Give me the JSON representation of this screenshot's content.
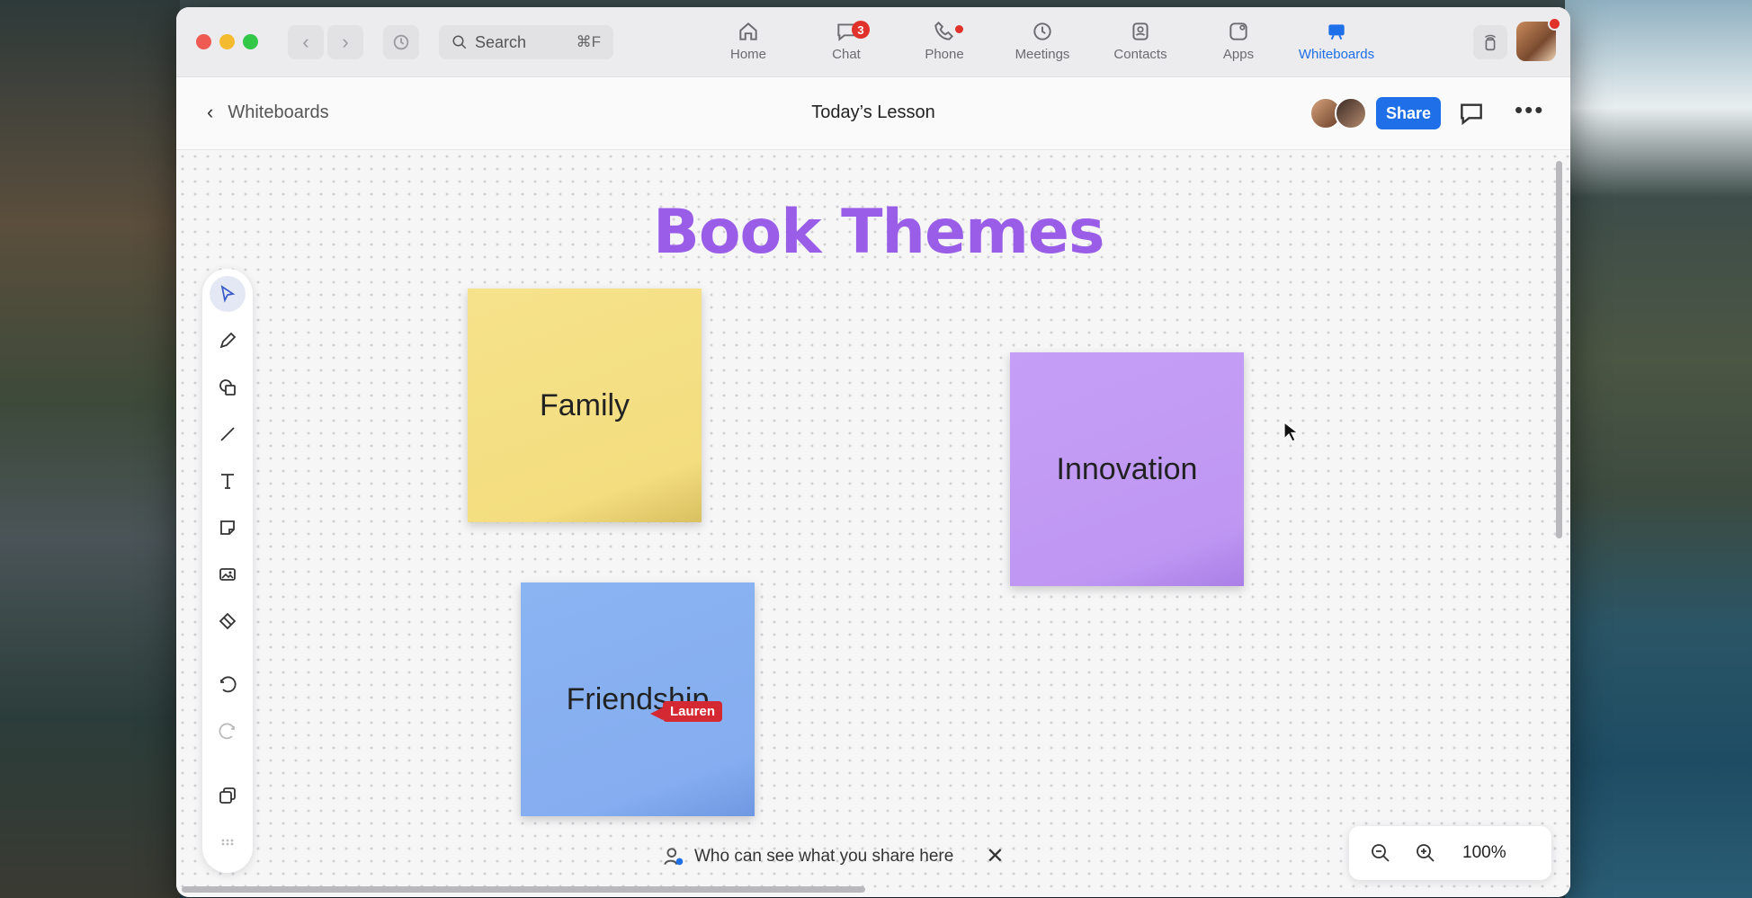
{
  "search": {
    "label": "Search",
    "shortcut": "⌘F"
  },
  "nav_tabs": [
    {
      "label": "Home",
      "icon": "home-icon"
    },
    {
      "label": "Chat",
      "icon": "chat-icon",
      "badge": "3"
    },
    {
      "label": "Phone",
      "icon": "phone-icon"
    },
    {
      "label": "Meetings",
      "icon": "clock-icon"
    },
    {
      "label": "Contacts",
      "icon": "contacts-icon"
    },
    {
      "label": "Apps",
      "icon": "apps-icon"
    },
    {
      "label": "Whiteboards",
      "icon": "whiteboard-icon",
      "active": true
    }
  ],
  "subbar": {
    "back_label": "Whiteboards",
    "title": "Today’s Lesson",
    "share_label": "Share"
  },
  "board": {
    "title": "Book Themes",
    "title_color": "#9a5de8",
    "notes": [
      {
        "text": "Family",
        "color": "#f3dd7f"
      },
      {
        "text": "Innovation",
        "color": "#bf97f3"
      },
      {
        "text": "Friendship",
        "color": "#85adf0"
      }
    ],
    "collaborator_cursor": "Lauren"
  },
  "tools": [
    "select-icon",
    "pen-icon",
    "shapes-icon",
    "line-icon",
    "text-icon",
    "sticky-note-icon",
    "image-icon",
    "eraser-icon",
    "undo-icon",
    "redo-icon",
    "pages-icon",
    "more-icon"
  ],
  "privacy_notice": "Who can see what you share here",
  "zoom": {
    "level": "100%"
  },
  "accent_color": "#1e6fe8"
}
